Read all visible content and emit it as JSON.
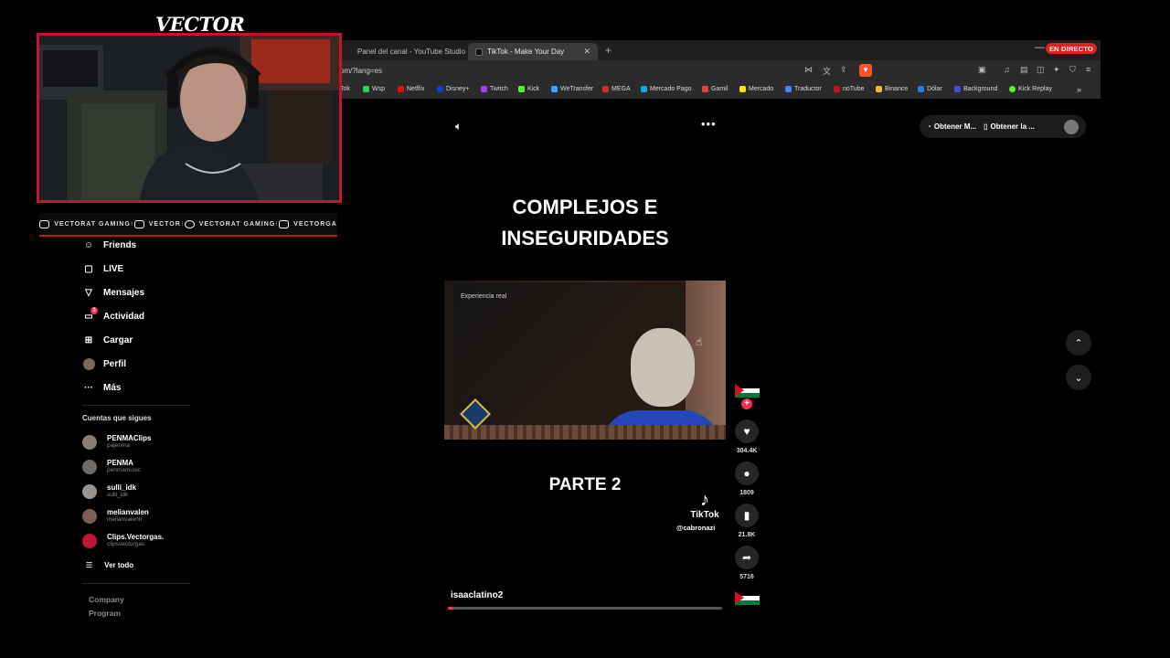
{
  "browser": {
    "tabs": [
      {
        "label": "Panel del canal - YouTube Studio",
        "color": "#ff0000"
      },
      {
        "label": "TikTok - Make Your Day",
        "color": "#111111"
      }
    ],
    "new_tab": "+",
    "minimize": "—",
    "live_badge": "EN DIRECTO",
    "url": "om/?lang=es",
    "bookmarks": [
      {
        "label": "Tok",
        "color": "#111111"
      },
      {
        "label": "Wsp",
        "color": "#25d366"
      },
      {
        "label": "Netflix",
        "color": "#e50914"
      },
      {
        "label": "Disney+",
        "color": "#113ccf"
      },
      {
        "label": "Twitch",
        "color": "#9146ff"
      },
      {
        "label": "Kick",
        "color": "#53fc18"
      },
      {
        "label": "WeTransfer",
        "color": "#409fff"
      },
      {
        "label": "MEGA",
        "color": "#d9272e"
      },
      {
        "label": "Mercado Pago",
        "color": "#00b1ea"
      },
      {
        "label": "Gamil",
        "color": "#ea4335"
      },
      {
        "label": "Mercado",
        "color": "#ffe600"
      },
      {
        "label": "Traductor",
        "color": "#4285f4"
      },
      {
        "label": "noTube",
        "color": "#c8102e"
      },
      {
        "label": "Binance",
        "color": "#f3ba2f"
      },
      {
        "label": "Dólar",
        "color": "#2b7bd8"
      },
      {
        "label": "Background",
        "color": "#4a4ad8"
      },
      {
        "label": "Kick Replay",
        "color": "#53fc18"
      }
    ],
    "bookmarks_more": "»"
  },
  "overlay": {
    "logo": "VECTOR",
    "social": [
      {
        "label": "VECTORAT GAMING"
      },
      {
        "label": "VECTOR"
      },
      {
        "label": "VECTORAT GAMING"
      },
      {
        "label": "VECTORGA"
      }
    ],
    "separator": "I"
  },
  "sidebar": {
    "nav": [
      {
        "label": "Friends",
        "icon": "users-icon"
      },
      {
        "label": "LIVE",
        "icon": "live-tv-icon"
      },
      {
        "label": "Mensajes",
        "icon": "send-icon"
      },
      {
        "label": "Actividad",
        "icon": "activity-icon"
      },
      {
        "label": "Cargar",
        "icon": "upload-icon"
      },
      {
        "label": "Perfil",
        "icon": "avatar-icon"
      },
      {
        "label": "Más",
        "icon": "more-icon"
      }
    ],
    "activity_badge": "3",
    "following_title": "Cuentas que sigues",
    "accounts": [
      {
        "name": "PENMAClips",
        "handle": "pajenma"
      },
      {
        "name": "PENMA",
        "handle": "penmamusic"
      },
      {
        "name": "sulli_idk",
        "handle": "sulli_idk"
      },
      {
        "name": "melianvalen",
        "handle": "melianvalenn"
      },
      {
        "name": "Clips.Vectorgas.",
        "handle": "clipsvectorgas"
      }
    ],
    "see_all": "Ver todo",
    "footer": [
      "Company",
      "Program"
    ]
  },
  "top_actions": {
    "volume_icon": "speaker-icon",
    "more": "•••",
    "pill": {
      "left": "Obtener M...",
      "right": "Obtener la ..."
    }
  },
  "video": {
    "title_line1": "COMPLEJOS E",
    "title_line2": "INSEGURIDADES",
    "clip_label": "Experiencia real",
    "part": "PARTE 2",
    "tiktok_brand": "TikTok",
    "tiktok_handle": "@cabronazi",
    "username": "isaaclatino2",
    "progress": 0.01
  },
  "actions": {
    "follow_plus": "+",
    "likes": "304.4K",
    "comments": "1809",
    "saves": "21.8K",
    "shares": "5716"
  },
  "nav_arrows": {
    "up": "⌃",
    "down": "⌄"
  }
}
